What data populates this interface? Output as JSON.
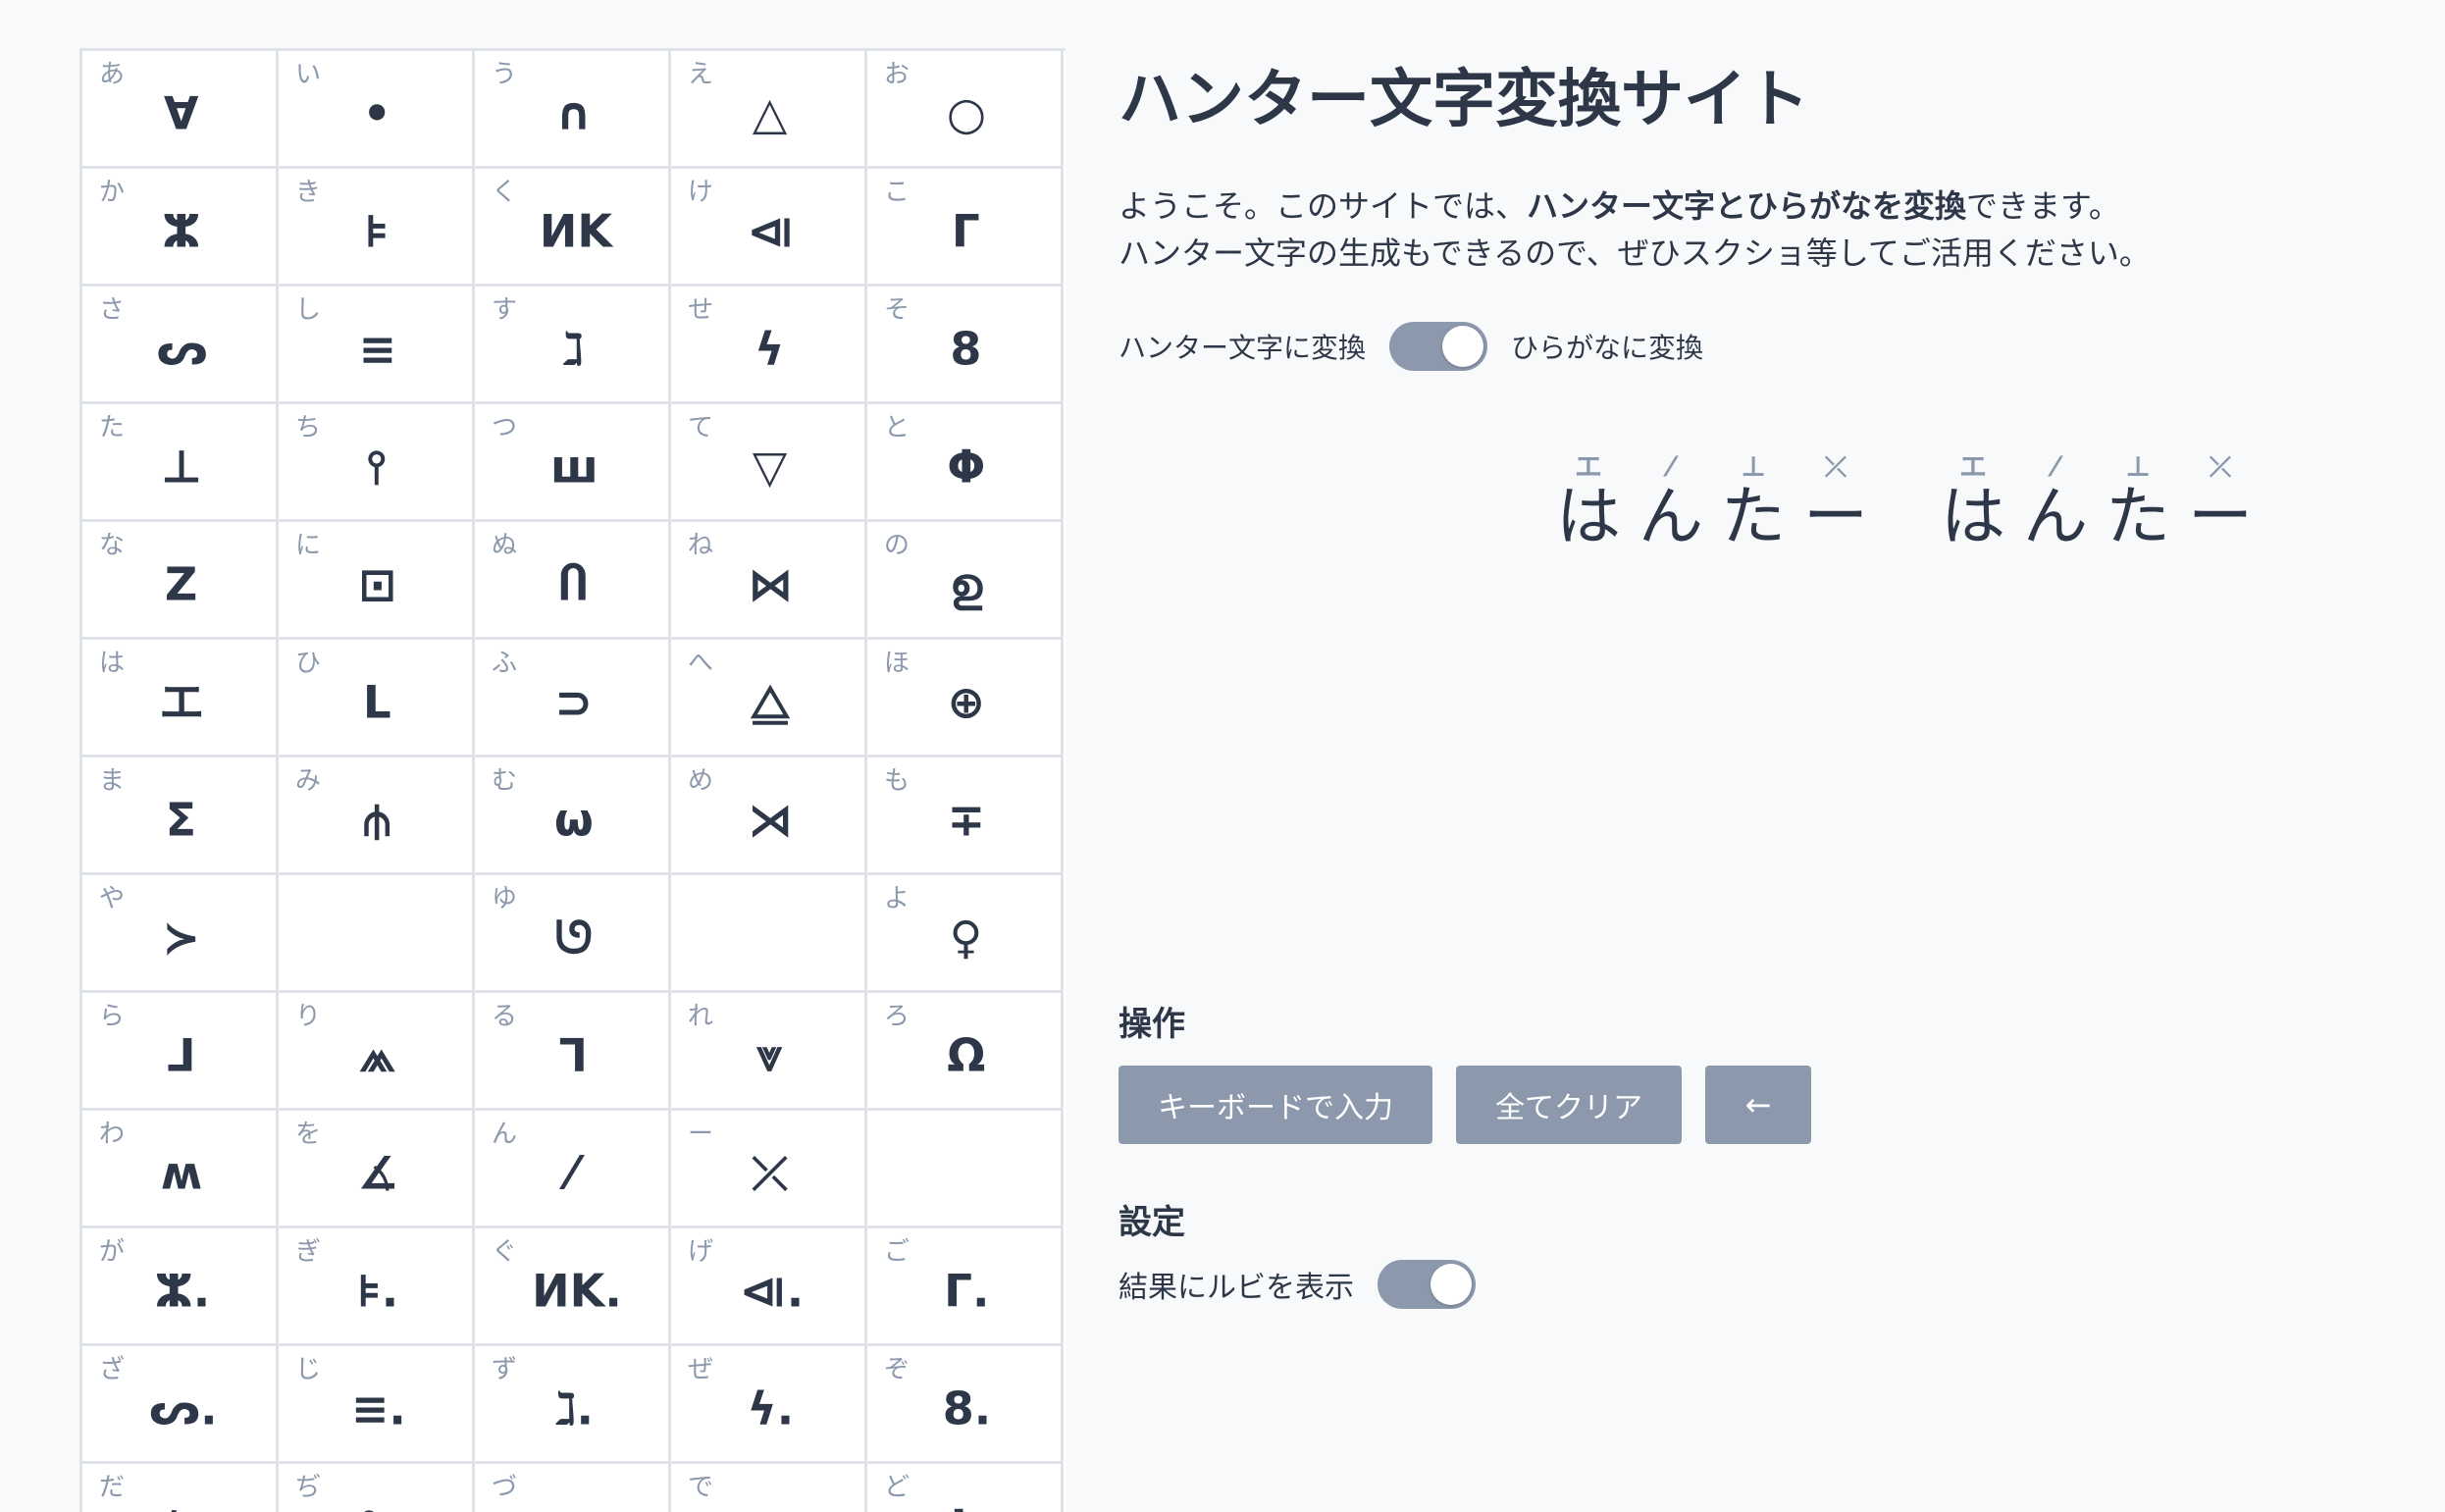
{
  "page": {
    "title": "ハンター文字変換サイト",
    "intro_line1_before": "ようこそ。このサイトでは、",
    "intro_line1_bold": "ハンター文字とひらがなを変換",
    "intro_line1_after": "できます。",
    "intro_line2": "ハンター文字の生成もできるので、ぜひスクショ等してご活用ください。"
  },
  "mode_toggle": {
    "left_label": "ハンター文字に変換",
    "right_label": "ひらがなに変換",
    "state": "on"
  },
  "result": {
    "groups": [
      [
        {
          "ruby": "エ",
          "char": "は"
        },
        {
          "ruby": "⁄",
          "char": "ん"
        },
        {
          "ruby": "⊥",
          "char": "た"
        },
        {
          "ruby": "⤫",
          "char": "ー"
        }
      ],
      [
        {
          "ruby": "エ",
          "char": "は"
        },
        {
          "ruby": "⁄",
          "char": "ん"
        },
        {
          "ruby": "⊥",
          "char": "た"
        },
        {
          "ruby": "⤫",
          "char": "ー"
        }
      ]
    ]
  },
  "operations": {
    "heading": "操作",
    "keyboard_button": "キーボードで入力",
    "clear_button": "全てクリア",
    "back_button": "←"
  },
  "settings": {
    "heading": "設定",
    "ruby_label": "結果にルビを表示",
    "ruby_state": "on"
  },
  "table": {
    "cells": [
      {
        "kana": "あ",
        "glyph": "∀"
      },
      {
        "kana": "い",
        "glyph": "•"
      },
      {
        "kana": "う",
        "glyph": "∩"
      },
      {
        "kana": "え",
        "glyph": "△"
      },
      {
        "kana": "お",
        "glyph": "○"
      },
      {
        "kana": "か",
        "glyph": "ⵣ"
      },
      {
        "kana": "き",
        "glyph": "⊧"
      },
      {
        "kana": "く",
        "glyph": "ⵍK"
      },
      {
        "kana": "け",
        "glyph": "⧏"
      },
      {
        "kana": "こ",
        "glyph": "ᒥ"
      },
      {
        "kana": "さ",
        "glyph": "ᔕ"
      },
      {
        "kana": "し",
        "glyph": "≡"
      },
      {
        "kana": "す",
        "glyph": "ℷ"
      },
      {
        "kana": "せ",
        "glyph": "ϟ"
      },
      {
        "kana": "そ",
        "glyph": "8"
      },
      {
        "kana": "た",
        "glyph": "⊥"
      },
      {
        "kana": "ち",
        "glyph": "⫯"
      },
      {
        "kana": "つ",
        "glyph": "ш"
      },
      {
        "kana": "て",
        "glyph": "▽"
      },
      {
        "kana": "と",
        "glyph": "Φ"
      },
      {
        "kana": "な",
        "glyph": "Z"
      },
      {
        "kana": "に",
        "glyph": "⊡"
      },
      {
        "kana": "ぬ",
        "glyph": "Ⴖ"
      },
      {
        "kana": "ね",
        "glyph": "⋈"
      },
      {
        "kana": "の",
        "glyph": "ഉ"
      },
      {
        "kana": "は",
        "glyph": "エ"
      },
      {
        "kana": "ひ",
        "glyph": "ᒪ"
      },
      {
        "kana": "ふ",
        "glyph": "⊃"
      },
      {
        "kana": "へ",
        "glyph": "⧋"
      },
      {
        "kana": "ほ",
        "glyph": "⊕"
      },
      {
        "kana": "ま",
        "glyph": "Σ"
      },
      {
        "kana": "み",
        "glyph": "⫛"
      },
      {
        "kana": "む",
        "glyph": "ω"
      },
      {
        "kana": "め",
        "glyph": "⋊"
      },
      {
        "kana": "も",
        "glyph": "∓"
      },
      {
        "kana": "や",
        "glyph": "≻"
      },
      {
        "kana": "",
        "glyph": ""
      },
      {
        "kana": "ゆ",
        "glyph": "ᘎ"
      },
      {
        "kana": "",
        "glyph": ""
      },
      {
        "kana": "よ",
        "glyph": "♀"
      },
      {
        "kana": "ら",
        "glyph": "⅃"
      },
      {
        "kana": "り",
        "glyph": "⩕"
      },
      {
        "kana": "る",
        "glyph": "Ꞁ"
      },
      {
        "kana": "れ",
        "glyph": "⩔"
      },
      {
        "kana": "ろ",
        "glyph": "Ω"
      },
      {
        "kana": "わ",
        "glyph": "ʍ"
      },
      {
        "kana": "を",
        "glyph": "∡"
      },
      {
        "kana": "ん",
        "glyph": "⁄"
      },
      {
        "kana": "ー",
        "glyph": "⤫"
      },
      {
        "kana": "",
        "glyph": ""
      },
      {
        "kana": "が",
        "glyph": "ⵣ."
      },
      {
        "kana": "ぎ",
        "glyph": "⊧."
      },
      {
        "kana": "ぐ",
        "glyph": "ⵍK."
      },
      {
        "kana": "げ",
        "glyph": "⧏."
      },
      {
        "kana": "ご",
        "glyph": "ᒥ."
      },
      {
        "kana": "ざ",
        "glyph": "ᔕ."
      },
      {
        "kana": "じ",
        "glyph": "≡."
      },
      {
        "kana": "ず",
        "glyph": "ℷ."
      },
      {
        "kana": "ぜ",
        "glyph": "ϟ."
      },
      {
        "kana": "ぞ",
        "glyph": "8."
      },
      {
        "kana": "だ",
        "glyph": "⊥."
      },
      {
        "kana": "ぢ",
        "glyph": "⫯."
      },
      {
        "kana": "づ",
        "glyph": "ш."
      },
      {
        "kana": "で",
        "glyph": "▽."
      },
      {
        "kana": "ど",
        "glyph": "Φ."
      }
    ]
  }
}
